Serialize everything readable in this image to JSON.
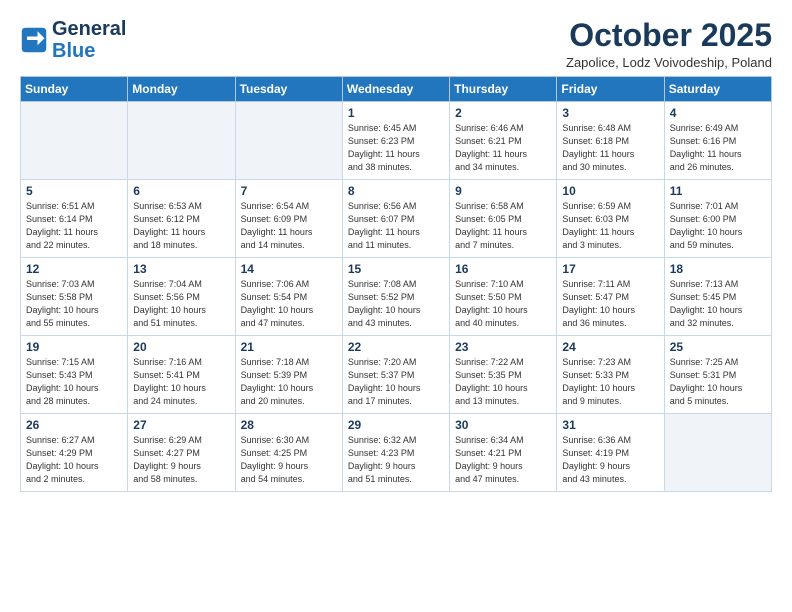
{
  "header": {
    "logo_general": "General",
    "logo_blue": "Blue",
    "month_title": "October 2025",
    "subtitle": "Zapolice, Lodz Voivodeship, Poland"
  },
  "weekdays": [
    "Sunday",
    "Monday",
    "Tuesday",
    "Wednesday",
    "Thursday",
    "Friday",
    "Saturday"
  ],
  "weeks": [
    [
      {
        "day": "",
        "info": ""
      },
      {
        "day": "",
        "info": ""
      },
      {
        "day": "",
        "info": ""
      },
      {
        "day": "1",
        "info": "Sunrise: 6:45 AM\nSunset: 6:23 PM\nDaylight: 11 hours\nand 38 minutes."
      },
      {
        "day": "2",
        "info": "Sunrise: 6:46 AM\nSunset: 6:21 PM\nDaylight: 11 hours\nand 34 minutes."
      },
      {
        "day": "3",
        "info": "Sunrise: 6:48 AM\nSunset: 6:18 PM\nDaylight: 11 hours\nand 30 minutes."
      },
      {
        "day": "4",
        "info": "Sunrise: 6:49 AM\nSunset: 6:16 PM\nDaylight: 11 hours\nand 26 minutes."
      }
    ],
    [
      {
        "day": "5",
        "info": "Sunrise: 6:51 AM\nSunset: 6:14 PM\nDaylight: 11 hours\nand 22 minutes."
      },
      {
        "day": "6",
        "info": "Sunrise: 6:53 AM\nSunset: 6:12 PM\nDaylight: 11 hours\nand 18 minutes."
      },
      {
        "day": "7",
        "info": "Sunrise: 6:54 AM\nSunset: 6:09 PM\nDaylight: 11 hours\nand 14 minutes."
      },
      {
        "day": "8",
        "info": "Sunrise: 6:56 AM\nSunset: 6:07 PM\nDaylight: 11 hours\nand 11 minutes."
      },
      {
        "day": "9",
        "info": "Sunrise: 6:58 AM\nSunset: 6:05 PM\nDaylight: 11 hours\nand 7 minutes."
      },
      {
        "day": "10",
        "info": "Sunrise: 6:59 AM\nSunset: 6:03 PM\nDaylight: 11 hours\nand 3 minutes."
      },
      {
        "day": "11",
        "info": "Sunrise: 7:01 AM\nSunset: 6:00 PM\nDaylight: 10 hours\nand 59 minutes."
      }
    ],
    [
      {
        "day": "12",
        "info": "Sunrise: 7:03 AM\nSunset: 5:58 PM\nDaylight: 10 hours\nand 55 minutes."
      },
      {
        "day": "13",
        "info": "Sunrise: 7:04 AM\nSunset: 5:56 PM\nDaylight: 10 hours\nand 51 minutes."
      },
      {
        "day": "14",
        "info": "Sunrise: 7:06 AM\nSunset: 5:54 PM\nDaylight: 10 hours\nand 47 minutes."
      },
      {
        "day": "15",
        "info": "Sunrise: 7:08 AM\nSunset: 5:52 PM\nDaylight: 10 hours\nand 43 minutes."
      },
      {
        "day": "16",
        "info": "Sunrise: 7:10 AM\nSunset: 5:50 PM\nDaylight: 10 hours\nand 40 minutes."
      },
      {
        "day": "17",
        "info": "Sunrise: 7:11 AM\nSunset: 5:47 PM\nDaylight: 10 hours\nand 36 minutes."
      },
      {
        "day": "18",
        "info": "Sunrise: 7:13 AM\nSunset: 5:45 PM\nDaylight: 10 hours\nand 32 minutes."
      }
    ],
    [
      {
        "day": "19",
        "info": "Sunrise: 7:15 AM\nSunset: 5:43 PM\nDaylight: 10 hours\nand 28 minutes."
      },
      {
        "day": "20",
        "info": "Sunrise: 7:16 AM\nSunset: 5:41 PM\nDaylight: 10 hours\nand 24 minutes."
      },
      {
        "day": "21",
        "info": "Sunrise: 7:18 AM\nSunset: 5:39 PM\nDaylight: 10 hours\nand 20 minutes."
      },
      {
        "day": "22",
        "info": "Sunrise: 7:20 AM\nSunset: 5:37 PM\nDaylight: 10 hours\nand 17 minutes."
      },
      {
        "day": "23",
        "info": "Sunrise: 7:22 AM\nSunset: 5:35 PM\nDaylight: 10 hours\nand 13 minutes."
      },
      {
        "day": "24",
        "info": "Sunrise: 7:23 AM\nSunset: 5:33 PM\nDaylight: 10 hours\nand 9 minutes."
      },
      {
        "day": "25",
        "info": "Sunrise: 7:25 AM\nSunset: 5:31 PM\nDaylight: 10 hours\nand 5 minutes."
      }
    ],
    [
      {
        "day": "26",
        "info": "Sunrise: 6:27 AM\nSunset: 4:29 PM\nDaylight: 10 hours\nand 2 minutes."
      },
      {
        "day": "27",
        "info": "Sunrise: 6:29 AM\nSunset: 4:27 PM\nDaylight: 9 hours\nand 58 minutes."
      },
      {
        "day": "28",
        "info": "Sunrise: 6:30 AM\nSunset: 4:25 PM\nDaylight: 9 hours\nand 54 minutes."
      },
      {
        "day": "29",
        "info": "Sunrise: 6:32 AM\nSunset: 4:23 PM\nDaylight: 9 hours\nand 51 minutes."
      },
      {
        "day": "30",
        "info": "Sunrise: 6:34 AM\nSunset: 4:21 PM\nDaylight: 9 hours\nand 47 minutes."
      },
      {
        "day": "31",
        "info": "Sunrise: 6:36 AM\nSunset: 4:19 PM\nDaylight: 9 hours\nand 43 minutes."
      },
      {
        "day": "",
        "info": ""
      }
    ]
  ]
}
